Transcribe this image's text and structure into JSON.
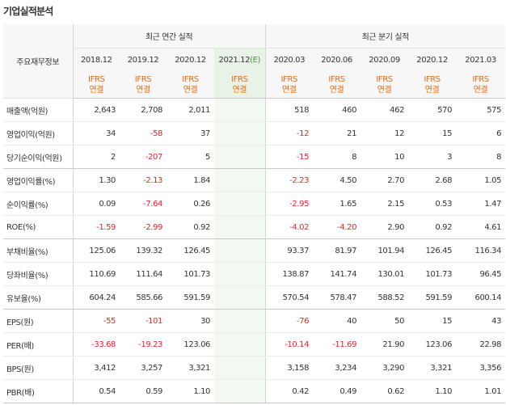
{
  "page_title": "기업실적분석",
  "header": {
    "corner": "주요재무정보",
    "annual_title": "최근 연간 실적",
    "quarter_title": "최근 분기 실적",
    "annual_periods": [
      {
        "period": "2018.12"
      },
      {
        "period": "2019.12"
      },
      {
        "period": "2020.12"
      },
      {
        "period": "2021.12",
        "estimate_mark": "(E)"
      }
    ],
    "quarter_periods": [
      {
        "period": "2020.03"
      },
      {
        "period": "2020.06"
      },
      {
        "period": "2020.09"
      },
      {
        "period": "2020.12"
      },
      {
        "period": "2021.03"
      }
    ],
    "basis_line1": "IFRS",
    "basis_line2": "연결"
  },
  "colors": {
    "negative": "#e8232b",
    "basis": "#e26b12",
    "estimate_mark": "#3c9a34",
    "estimate_bg": "#f3f8f1"
  },
  "rows": [
    {
      "label": "매출액(억원)",
      "annual": [
        "2,643",
        "2,708",
        "2,011",
        ""
      ],
      "quarter": [
        "518",
        "460",
        "462",
        "570",
        "575"
      ]
    },
    {
      "label": "영업이익(억원)",
      "annual": [
        "34",
        "-58",
        "37",
        ""
      ],
      "quarter": [
        "-12",
        "21",
        "12",
        "15",
        "6"
      ]
    },
    {
      "label": "당기순이익(억원)",
      "annual": [
        "2",
        "-207",
        "5",
        ""
      ],
      "quarter": [
        "-15",
        "8",
        "10",
        "3",
        "8"
      ]
    },
    {
      "label": "영업이익률(%)",
      "annual": [
        "1.30",
        "-2.13",
        "1.84",
        ""
      ],
      "quarter": [
        "-2.23",
        "4.50",
        "2.70",
        "2.68",
        "1.05"
      ]
    },
    {
      "label": "순이익률(%)",
      "annual": [
        "0.09",
        "-7.64",
        "0.26",
        ""
      ],
      "quarter": [
        "-2.95",
        "1.65",
        "2.15",
        "0.53",
        "1.47"
      ]
    },
    {
      "label": "ROE(%)",
      "annual": [
        "-1.59",
        "-2.99",
        "0.92",
        ""
      ],
      "quarter": [
        "-4.02",
        "-4.20",
        "2.90",
        "0.92",
        "4.61"
      ]
    },
    {
      "label": "부채비율(%)",
      "annual": [
        "125.06",
        "139.32",
        "126.45",
        ""
      ],
      "quarter": [
        "93.37",
        "81.97",
        "101.94",
        "126.45",
        "116.34"
      ]
    },
    {
      "label": "당좌비율(%)",
      "annual": [
        "110.69",
        "111.64",
        "101.73",
        ""
      ],
      "quarter": [
        "138.87",
        "141.74",
        "130.01",
        "101.73",
        "96.45"
      ]
    },
    {
      "label": "유보율(%)",
      "annual": [
        "604.24",
        "585.66",
        "591.59",
        ""
      ],
      "quarter": [
        "570.54",
        "578.47",
        "588.52",
        "591.59",
        "600.14"
      ]
    },
    {
      "label": "EPS(원)",
      "annual": [
        "-55",
        "-101",
        "30",
        ""
      ],
      "quarter": [
        "-76",
        "40",
        "50",
        "15",
        "43"
      ]
    },
    {
      "label": "PER(배)",
      "annual": [
        "-33.68",
        "-19.23",
        "123.06",
        ""
      ],
      "quarter": [
        "-10.14",
        "-11.69",
        "21.90",
        "123.06",
        "22.98"
      ]
    },
    {
      "label": "BPS(원)",
      "annual": [
        "3,412",
        "3,257",
        "3,321",
        ""
      ],
      "quarter": [
        "3,158",
        "3,234",
        "3,290",
        "3,321",
        "3,356"
      ]
    },
    {
      "label": "PBR(배)",
      "annual": [
        "0.54",
        "0.59",
        "1.10",
        ""
      ],
      "quarter": [
        "0.42",
        "0.49",
        "0.62",
        "1.10",
        "1.01"
      ]
    }
  ]
}
